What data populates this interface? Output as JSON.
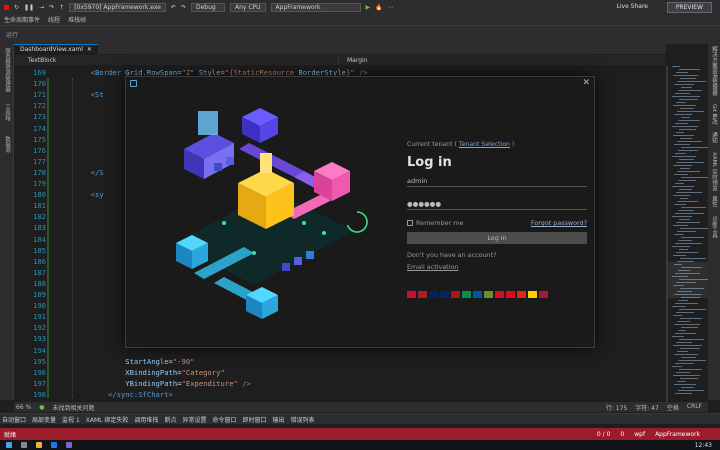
{
  "toolbar": {
    "process_label": "[0x5970] AppFramework.exe",
    "config": "Debug",
    "platform": "Any CPU",
    "startup_project": "AppFramework",
    "live_share": "Live Share",
    "preview_label": "PREVIEW"
  },
  "toolbar2": {
    "lifecycle": "生命周期事件",
    "thread": "线程",
    "stack_frame": "堆栈帧"
  },
  "toolbar3": {
    "label": "运行"
  },
  "left_strip": [
    "服务器资源管理器",
    "工具箱",
    "数据源"
  ],
  "right_panel": [
    "解决方案资源管理器",
    "Git 更改",
    "通知",
    "XAML 实时预览",
    "属性",
    "诊断工具"
  ],
  "tabs": [
    {
      "label": "DashboardView.xaml",
      "close": "✕"
    }
  ],
  "address": {
    "left": "TextBlock",
    "right": "Margin"
  },
  "code_lines": [
    {
      "n": "169",
      "parts": [
        {
          "c": "txt",
          "t": "        "
        },
        {
          "c": "tag",
          "t": "<Border "
        },
        {
          "c": "attr",
          "t": "Grid.RowSpan"
        },
        {
          "c": "txt",
          "t": "="
        },
        {
          "c": "val",
          "t": "\"2\" "
        },
        {
          "c": "attr",
          "t": "Style"
        },
        {
          "c": "txt",
          "t": "="
        },
        {
          "c": "val",
          "t": "\"{StaticResource "
        },
        {
          "c": "attr",
          "t": "BorderStyle"
        },
        {
          "c": "val",
          "t": "}\""
        },
        {
          "c": "tag",
          "t": " />"
        }
      ]
    },
    {
      "n": "170",
      "parts": []
    },
    {
      "n": "171",
      "parts": [
        {
          "c": "txt",
          "t": "        "
        },
        {
          "c": "tag",
          "t": "<St"
        }
      ]
    },
    {
      "n": "172",
      "parts": []
    },
    {
      "n": "173",
      "parts": [
        {
          "c": "txt",
          "t": "                                                                                    "
        },
        {
          "c": "val",
          "t": "tistics}\""
        },
        {
          "c": "tag",
          "t": " />"
        }
      ]
    },
    {
      "n": "174",
      "parts": []
    },
    {
      "n": "175",
      "parts": []
    },
    {
      "n": "176",
      "parts": []
    },
    {
      "n": "177",
      "parts": []
    },
    {
      "n": "178",
      "parts": [
        {
          "c": "txt",
          "t": "        "
        },
        {
          "c": "tag",
          "t": "</S"
        }
      ]
    },
    {
      "n": "179",
      "parts": []
    },
    {
      "n": "180",
      "parts": [
        {
          "c": "txt",
          "t": "        "
        },
        {
          "c": "tag",
          "t": "<sy"
        }
      ]
    },
    {
      "n": "181",
      "parts": []
    },
    {
      "n": "182",
      "parts": []
    },
    {
      "n": "183",
      "parts": []
    },
    {
      "n": "184",
      "parts": []
    },
    {
      "n": "185",
      "parts": []
    },
    {
      "n": "186",
      "parts": []
    },
    {
      "n": "187",
      "parts": []
    },
    {
      "n": "188",
      "parts": []
    },
    {
      "n": "189",
      "parts": []
    },
    {
      "n": "190",
      "parts": []
    },
    {
      "n": "191",
      "parts": []
    },
    {
      "n": "192",
      "parts": []
    },
    {
      "n": "193",
      "parts": []
    },
    {
      "n": "194",
      "parts": []
    },
    {
      "n": "195",
      "parts": [
        {
          "c": "txt",
          "t": "                "
        },
        {
          "c": "attr",
          "t": "StartAngle"
        },
        {
          "c": "txt",
          "t": "="
        },
        {
          "c": "val",
          "t": "\"-90\""
        }
      ]
    },
    {
      "n": "196",
      "parts": [
        {
          "c": "txt",
          "t": "                "
        },
        {
          "c": "attr",
          "t": "XBindingPath"
        },
        {
          "c": "txt",
          "t": "="
        },
        {
          "c": "val",
          "t": "\"Category\""
        }
      ]
    },
    {
      "n": "197",
      "parts": [
        {
          "c": "txt",
          "t": "                "
        },
        {
          "c": "attr",
          "t": "YBindingPath"
        },
        {
          "c": "txt",
          "t": "="
        },
        {
          "c": "val",
          "t": "\"Expenditure\""
        },
        {
          "c": "tag",
          "t": " />"
        }
      ]
    },
    {
      "n": "198",
      "parts": [
        {
          "c": "txt",
          "t": "            "
        },
        {
          "c": "tag",
          "t": "</sync:SfChart>"
        }
      ]
    },
    {
      "n": "199",
      "parts": [
        {
          "c": "txt",
          "t": "        "
        },
        {
          "c": "tag",
          "t": "</Grid>"
        }
      ]
    }
  ],
  "editor_status": {
    "zoom": "66 %",
    "issues": "未找到相关问题",
    "line": "行: 175",
    "char": "字符: 47",
    "spc": "空格",
    "crlf": "CRLF"
  },
  "bottom_tabs": [
    "自动窗口",
    "局部变量",
    "监视 1",
    "XAML 绑定失败",
    "调用堆栈",
    "断点",
    "异常设置",
    "命令窗口",
    "即时窗口",
    "输出",
    "错误列表"
  ],
  "status_bar": {
    "ready": "就绪",
    "errors": "0 / 0",
    "warnings": "0",
    "branch": "wpf",
    "project": "AppFramework"
  },
  "taskbar": {
    "time": "12:43"
  },
  "dialog": {
    "close": "✕",
    "tenant_prefix": "Current tenant ( ",
    "tenant_link": "Tenant Selection",
    "tenant_suffix": " )",
    "title": "Log in",
    "username": "admin",
    "password_mask": "●●●●●●",
    "remember": "Remember me",
    "forgot": "Forgot password?",
    "login_button": "Log in",
    "no_account": "Don't you have an account?",
    "email_activation": "Email activation",
    "flags": [
      "#c8102e",
      "#ae1c28",
      "#012169",
      "#002868",
      "#aa151b",
      "#009246",
      "#0055a4",
      "#6d8f2b",
      "#ce1126",
      "#e30a17",
      "#de2910",
      "#ffce00",
      "#a51931"
    ]
  },
  "colors": {
    "accent": "#007acc",
    "status": "#9c1c2c"
  }
}
